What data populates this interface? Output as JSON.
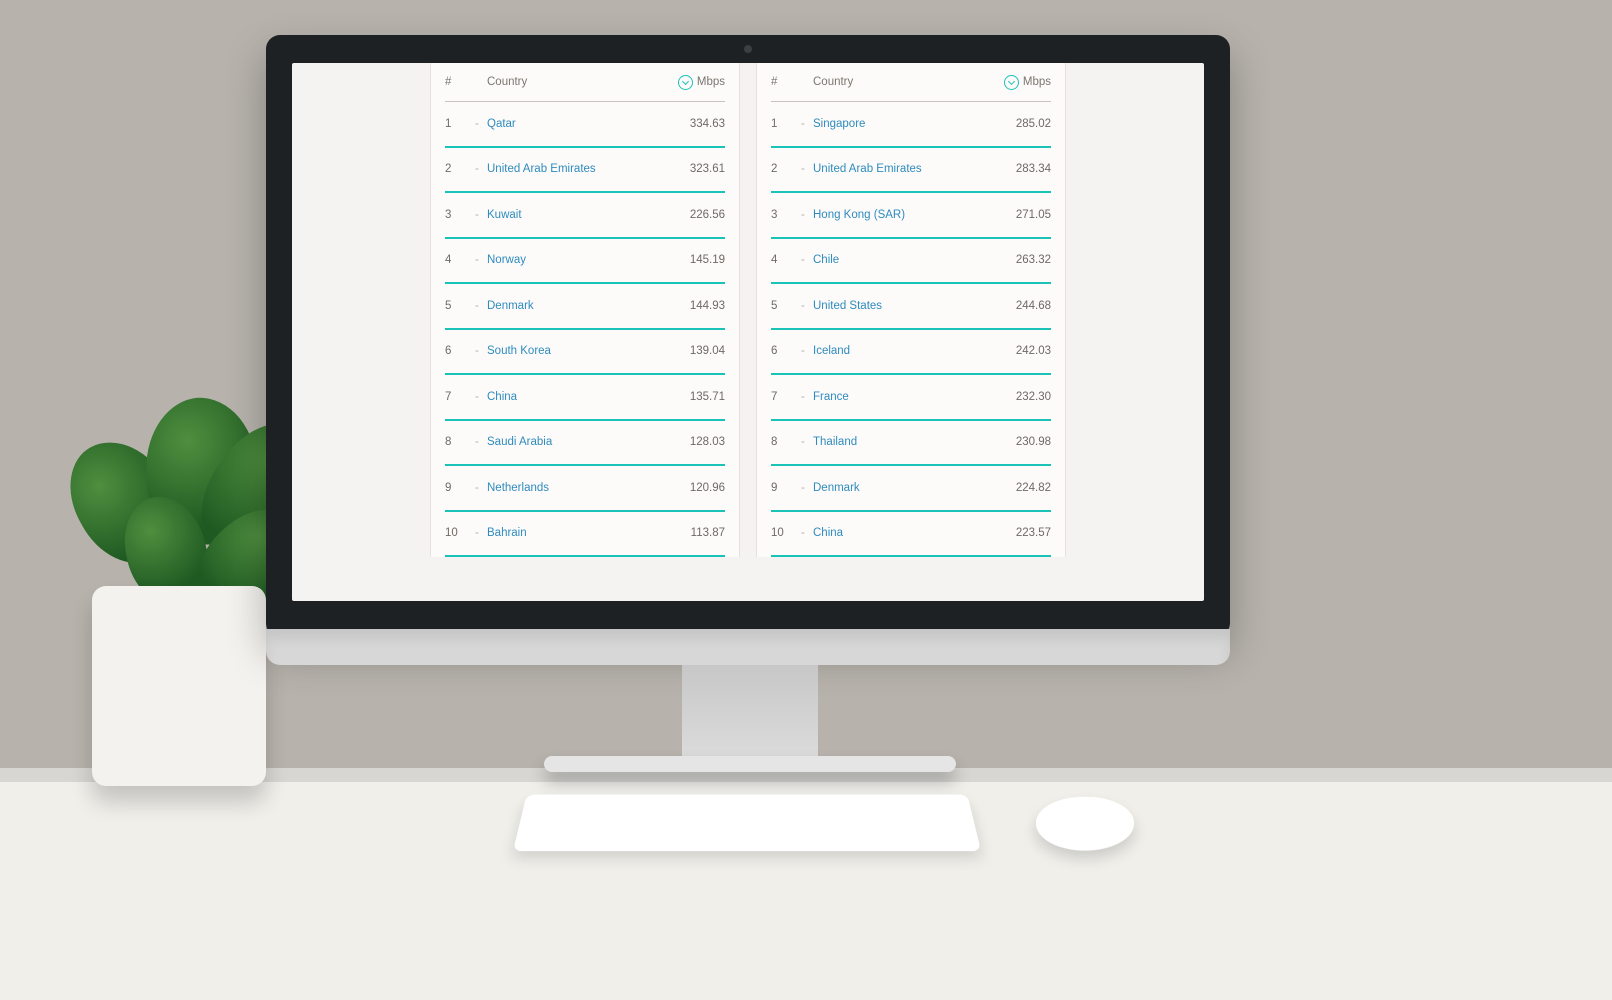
{
  "headers": {
    "rank": "#",
    "country": "Country",
    "mbps": "Mbps"
  },
  "chart_data": [
    {
      "type": "table",
      "columns": [
        "rank",
        "country",
        "mbps"
      ],
      "rows": [
        {
          "rank": "1",
          "country": "Qatar",
          "mbps": "334.63"
        },
        {
          "rank": "2",
          "country": "United Arab Emirates",
          "mbps": "323.61"
        },
        {
          "rank": "3",
          "country": "Kuwait",
          "mbps": "226.56"
        },
        {
          "rank": "4",
          "country": "Norway",
          "mbps": "145.19"
        },
        {
          "rank": "5",
          "country": "Denmark",
          "mbps": "144.93"
        },
        {
          "rank": "6",
          "country": "South Korea",
          "mbps": "139.04"
        },
        {
          "rank": "7",
          "country": "China",
          "mbps": "135.71"
        },
        {
          "rank": "8",
          "country": "Saudi Arabia",
          "mbps": "128.03"
        },
        {
          "rank": "9",
          "country": "Netherlands",
          "mbps": "120.96"
        },
        {
          "rank": "10",
          "country": "Bahrain",
          "mbps": "113.87"
        }
      ]
    },
    {
      "type": "table",
      "columns": [
        "rank",
        "country",
        "mbps"
      ],
      "rows": [
        {
          "rank": "1",
          "country": "Singapore",
          "mbps": "285.02"
        },
        {
          "rank": "2",
          "country": "United Arab Emirates",
          "mbps": "283.34"
        },
        {
          "rank": "3",
          "country": "Hong Kong (SAR)",
          "mbps": "271.05"
        },
        {
          "rank": "4",
          "country": "Chile",
          "mbps": "263.32"
        },
        {
          "rank": "5",
          "country": "United States",
          "mbps": "244.68"
        },
        {
          "rank": "6",
          "country": "Iceland",
          "mbps": "242.03"
        },
        {
          "rank": "7",
          "country": "France",
          "mbps": "232.30"
        },
        {
          "rank": "8",
          "country": "Thailand",
          "mbps": "230.98"
        },
        {
          "rank": "9",
          "country": "Denmark",
          "mbps": "224.82"
        },
        {
          "rank": "10",
          "country": "China",
          "mbps": "223.57"
        }
      ]
    }
  ]
}
